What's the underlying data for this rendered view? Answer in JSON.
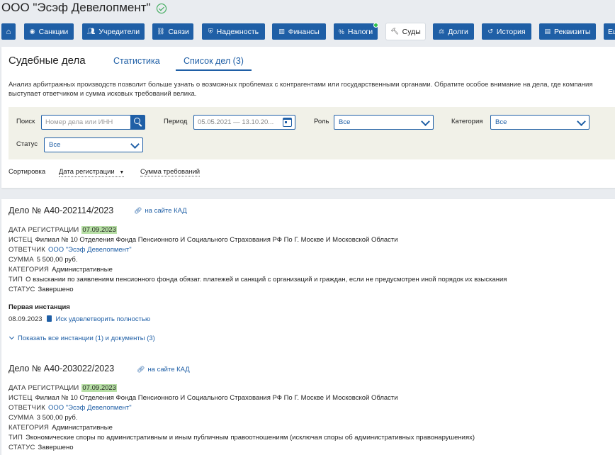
{
  "company": {
    "name": "ООО \"Эсэф Девелопмент\""
  },
  "nav": [
    {
      "label": "",
      "icon": "home-icon"
    },
    {
      "label": "Санкции",
      "icon": "globe-icon"
    },
    {
      "label": "Учредители",
      "icon": "users-icon"
    },
    {
      "label": "Связи",
      "icon": "links-icon"
    },
    {
      "label": "Надежность",
      "icon": "shield-icon"
    },
    {
      "label": "Финансы",
      "icon": "chart-icon"
    },
    {
      "label": "Налоги",
      "icon": "percent-icon"
    },
    {
      "label": "Суды",
      "icon": "gavel-icon"
    },
    {
      "label": "Долги",
      "icon": "scales-icon"
    },
    {
      "label": "История",
      "icon": "history-icon"
    },
    {
      "label": "Реквизиты",
      "icon": "document-icon"
    },
    {
      "label": "Ец",
      "icon": ""
    }
  ],
  "tabs": {
    "title": "Судебные дела",
    "stats": "Статистика",
    "list": "Список дел (3)"
  },
  "description": "Анализ арбитражных производств позволит больше узнать о возможных проблемах с контрагентами или государственными органами. Обратите особое внимание на дела, где компания выступает ответчиком и сумма исковых требований велика.",
  "filters": {
    "search_label": "Поиск",
    "search_placeholder": "Номер дела или ИНН",
    "period_label": "Период",
    "period_value": "05.05.2021 — 13.10.20...",
    "role_label": "Роль",
    "role_value": "Все",
    "category_label": "Категория",
    "category_value": "Все",
    "status_label": "Статус",
    "status_value": "Все"
  },
  "sort": {
    "label": "Сортировка",
    "opt1": "Дата регистрации",
    "opt2": "Сумма требований"
  },
  "labels": {
    "kad": "на сайте КАД",
    "reg_date": "ДАТА РЕГИСТРАЦИИ",
    "plaintiff": "ИСТЕЦ",
    "defendant": "ОТВЕТЧИК",
    "amount": "СУММА",
    "category": "КАТЕГОРИЯ",
    "type": "ТИП",
    "status": "СТАТУС"
  },
  "cases": [
    {
      "title": "Дело № А40-202114/2023",
      "reg_date": "07.09.2023",
      "plaintiff": "Филиал № 10 Отделения Фонда Пенсионного И Социального Страхования РФ По Г. Москве И Московской Области",
      "defendant": "ООО \"Эсэф Девелопмент\"",
      "amount": "5 500,00 руб.",
      "category": "Административные",
      "type": "О взыскании по заявлениям пенсионного фонда обязат. платежей и санкций с организаций и граждан, если не предусмотрен иной порядок их взыскания",
      "status": "Завершено",
      "instance_title": "Первая инстанция",
      "instance_date": "08.09.2023",
      "instance_doc": "Иск удовлетворить полностью",
      "show_all": "Показать все инстанции (1) и документы (3)"
    },
    {
      "title": "Дело № А40-203022/2023",
      "reg_date": "07.09.2023",
      "plaintiff": "Филиал № 10 Отделения Фонда Пенсионного И Социального Страхования РФ По Г. Москве И Московской Области",
      "defendant": "ООО \"Эсэф Девелопмент\"",
      "amount": "3 500,00 руб.",
      "category": "Административные",
      "type": "Экономические споры по административным и иным публичным правоотношениям (исключая споры об административных правонарушениях)",
      "status": "Завершено"
    }
  ]
}
